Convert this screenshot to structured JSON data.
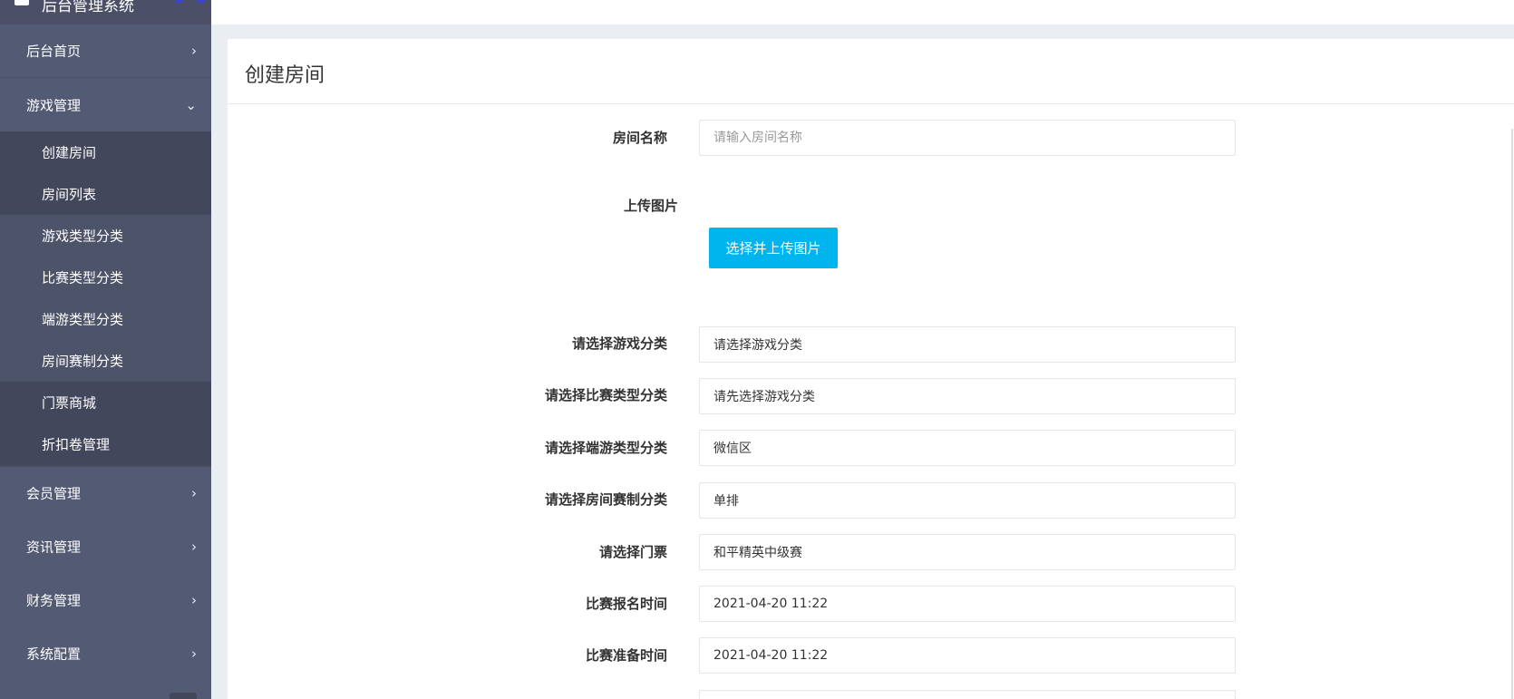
{
  "brand": {
    "title": "后台管理系统"
  },
  "sidebar": {
    "items": [
      {
        "label": "后台首页",
        "chevron": "›"
      },
      {
        "label": "游戏管理",
        "chevron": "⌄"
      },
      {
        "label": "会员管理",
        "chevron": "›"
      },
      {
        "label": "资讯管理",
        "chevron": "›"
      },
      {
        "label": "财务管理",
        "chevron": "›"
      },
      {
        "label": "系统配置",
        "chevron": "›"
      }
    ],
    "subitems": [
      {
        "label": "创建房间"
      },
      {
        "label": "房间列表"
      },
      {
        "label": "游戏类型分类"
      },
      {
        "label": "比赛类型分类"
      },
      {
        "label": "端游类型分类"
      },
      {
        "label": "房间赛制分类"
      },
      {
        "label": "门票商城"
      },
      {
        "label": "折扣卷管理"
      }
    ]
  },
  "page": {
    "title": "创建房间"
  },
  "form": {
    "room_name": {
      "label": "房间名称",
      "placeholder": "请输入房间名称"
    },
    "upload": {
      "label": "上传图片",
      "button": "选择并上传图片"
    },
    "game_category": {
      "label": "请选择游戏分类",
      "value": "请选择游戏分类"
    },
    "match_type": {
      "label": "请选择比赛类型分类",
      "value": "请先选择游戏分类"
    },
    "pc_game_type": {
      "label": "请选择端游类型分类",
      "value": "微信区"
    },
    "room_format": {
      "label": "请选择房间赛制分类",
      "value": "单排"
    },
    "ticket": {
      "label": "请选择门票",
      "value": "和平精英中级赛"
    },
    "signup_time": {
      "label": "比赛报名时间",
      "value": "2021-04-20 11:22"
    },
    "prepare_time": {
      "label": "比赛准备时间",
      "value": "2021-04-20 11:22"
    }
  }
}
